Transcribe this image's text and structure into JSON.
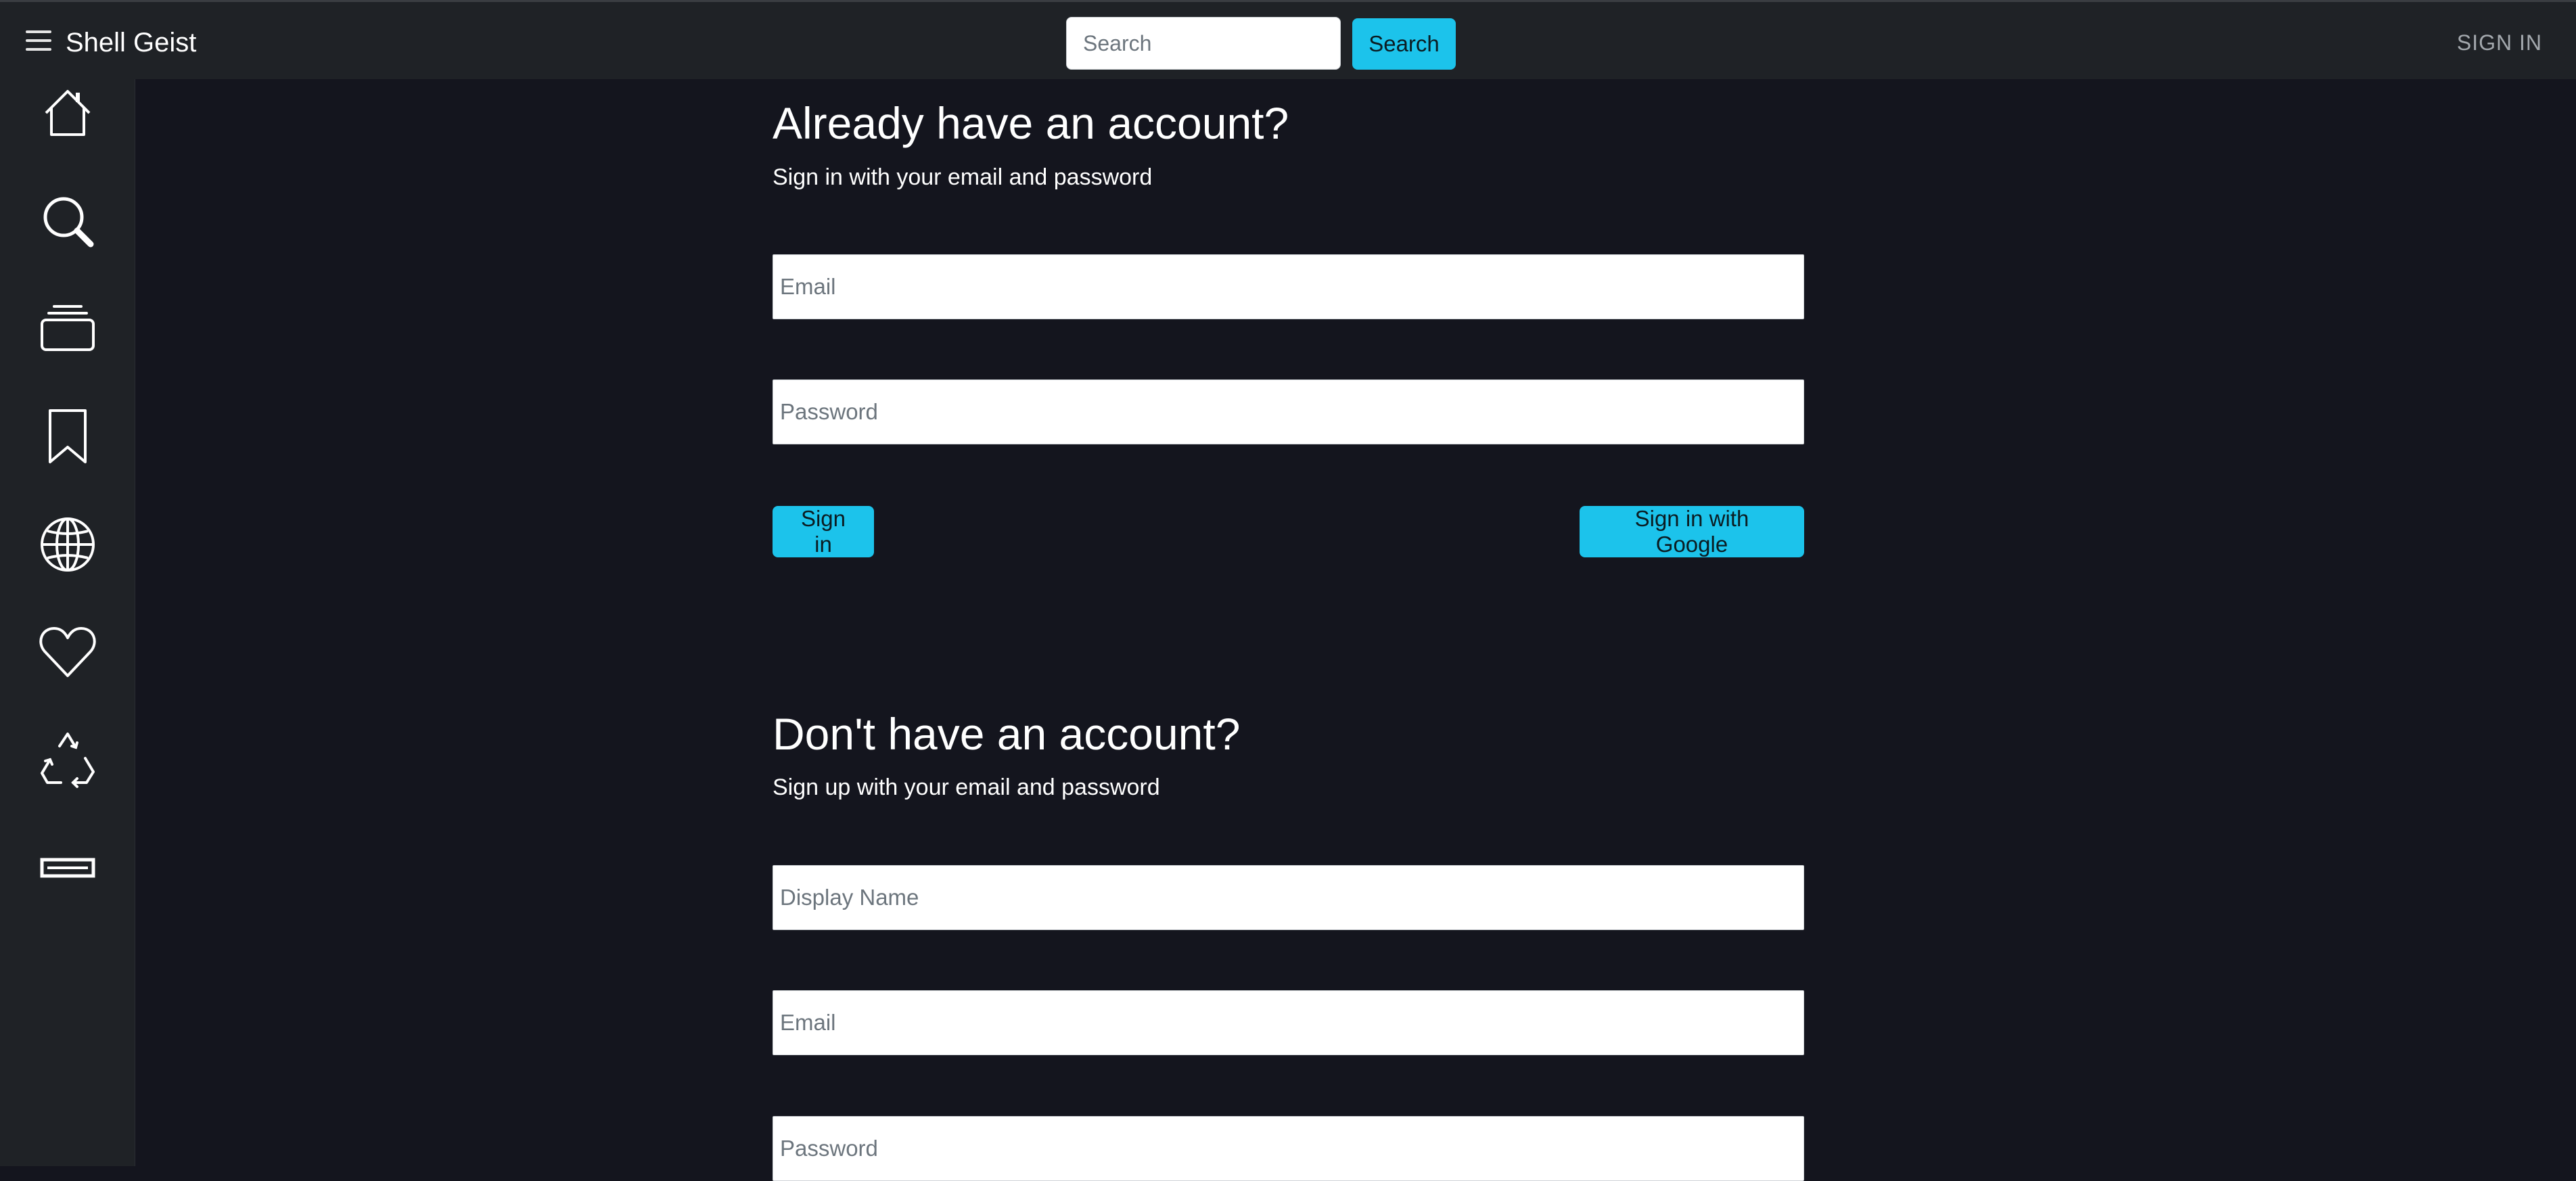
{
  "navbar": {
    "brand": "Shell Geist",
    "search_placeholder": "Search",
    "search_button": "Search",
    "sign_in": "SIGN IN"
  },
  "sidebar": {
    "items": [
      {
        "icon": "home-icon"
      },
      {
        "icon": "search-icon"
      },
      {
        "icon": "collection-icon"
      },
      {
        "icon": "bookmark-icon"
      },
      {
        "icon": "globe-icon"
      },
      {
        "icon": "heart-icon"
      },
      {
        "icon": "recycle-icon"
      },
      {
        "icon": "bar-icon"
      }
    ]
  },
  "signin": {
    "title": "Already have an account?",
    "subtitle": "Sign in with your email and password",
    "email_placeholder": "Email",
    "password_placeholder": "Password",
    "submit": "Sign in",
    "google": "Sign in with Google"
  },
  "signup": {
    "title": "Don't have an account?",
    "subtitle": "Sign up with your email and password",
    "display_name_placeholder": "Display Name",
    "email_placeholder": "Email",
    "password_placeholder": "Password"
  },
  "colors": {
    "accent": "#1cc3eb",
    "navbar_bg": "#1f2226",
    "page_bg": "#14151e"
  }
}
